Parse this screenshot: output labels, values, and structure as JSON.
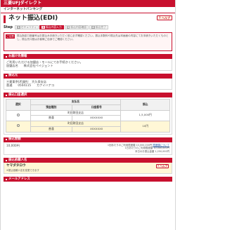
{
  "brand": "三菱UFJダイレクト",
  "subnav": "インターネットバンキング",
  "page_title": "ネット振込(EDI)",
  "help_label": "ヘルプ",
  "steps_label": "Step",
  "steps": [
    {
      "n": "1",
      "label": "セキュリティ"
    },
    {
      "n": "2",
      "label": "振込内容入力"
    },
    {
      "n": "3",
      "label": "振込内容確認"
    },
    {
      "n": "4",
      "label": "振込完了"
    }
  ],
  "notice": {
    "tag": "ご注意",
    "text": "振込指定口座番号はお振込み手続きいただく前に必ず確認ください。振込手数料や振込先は本画面の内容にてお手続きいただくものとし、振込先口座はお客様ご自身でご確認ください。"
  },
  "sections": {
    "recipient_info": "お届け先情報",
    "recipient_text": "ご利用いただける加盟店・モールにてお手続きください。",
    "merchant_label": "加盟店名",
    "merchant_value": "株式会社ペイジェント",
    "debit": "振込元",
    "debit_branch": "三菱東京UFJ銀行　大久保支店",
    "debit_type": "普通",
    "debit_account": "0504115",
    "debit_holder": "カナイハナコ",
    "dest": "振込口座選択",
    "amount": "振込金額",
    "amount_value": "10,000円",
    "payee": "振込依頼人名",
    "payee_name": "ヤマダタロウ",
    "payee_note": "※振込依頼人名を変更できます",
    "mail": "メールアドレス"
  },
  "dest_table": {
    "headers": {
      "select": "選択",
      "bank": "支払名",
      "branch": "預金種別",
      "account": "口座番号",
      "fee": "振込"
    },
    "rows": [
      {
        "bank": "町田財田支店",
        "type": "普通",
        "account": "XXXXXXX",
        "fee": "1,5,000円"
      },
      {
        "bank": "町田財田支店",
        "type": "普通",
        "account": "XXXXXXX",
        "fee": "10円"
      }
    ]
  },
  "limits": {
    "line1": "1回あたりのご利用限度額",
    "value1": "10,000,000円",
    "line2": "1日あたりのご利用限度額",
    "value2": "10,000,000円",
    "line3": "本日のお振込金額",
    "value3": "1,250,000円",
    "link": "限度額について"
  }
}
